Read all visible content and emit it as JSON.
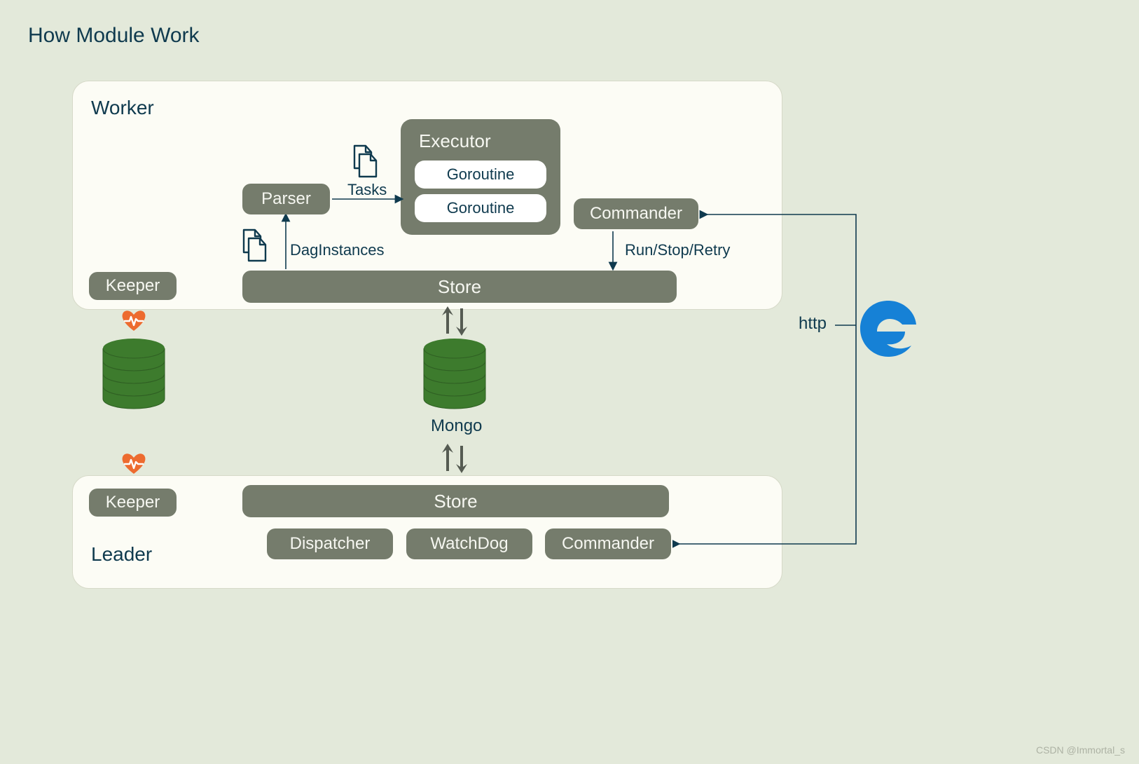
{
  "title": "How Module Work",
  "worker": {
    "label": "Worker",
    "keeper": "Keeper",
    "parser": "Parser",
    "executor": {
      "title": "Executor",
      "goroutine1": "Goroutine",
      "goroutine2": "Goroutine"
    },
    "commander": "Commander",
    "store": "Store",
    "labels": {
      "tasks": "Tasks",
      "dagInstances": "DagInstances",
      "runStopRetry": "Run/Stop/Retry"
    }
  },
  "leader": {
    "label": "Leader",
    "keeper": "Keeper",
    "store": "Store",
    "dispatcher": "Dispatcher",
    "watchdog": "WatchDog",
    "commander": "Commander"
  },
  "mongo": "Mongo",
  "http": "http",
  "watermark": "CSDN @Immortal_s"
}
